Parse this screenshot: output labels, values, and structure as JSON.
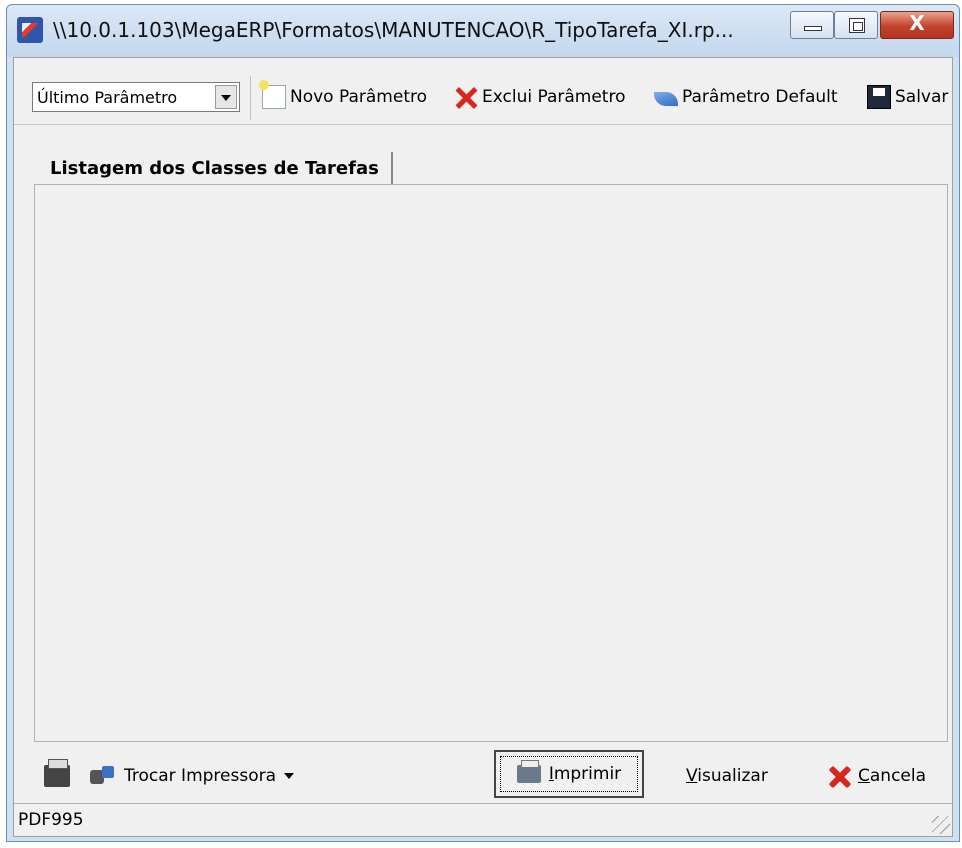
{
  "window": {
    "title": "\\\\10.0.1.103\\MegaERP\\Formatos\\MANUTENCAO\\R_TipoTarefa_XI.rp...",
    "close_label": "X"
  },
  "toolbar": {
    "combo_value": "Último Parâmetro",
    "new_label": "Novo Parâmetro",
    "delete_label": "Exclui Parâmetro",
    "default_label": "Parâmetro Default",
    "save_label": "Salvar"
  },
  "tab": {
    "label": "Listagem dos Classes de Tarefas"
  },
  "bottom": {
    "change_printer_label": "Trocar Impressora",
    "print_label_first": "I",
    "print_label_rest": "mprimir",
    "preview_label_first": "V",
    "preview_label_rest": "isualizar",
    "cancel_label_first": "C",
    "cancel_label_rest": "ancela"
  },
  "status": {
    "printer": "PDF995"
  }
}
